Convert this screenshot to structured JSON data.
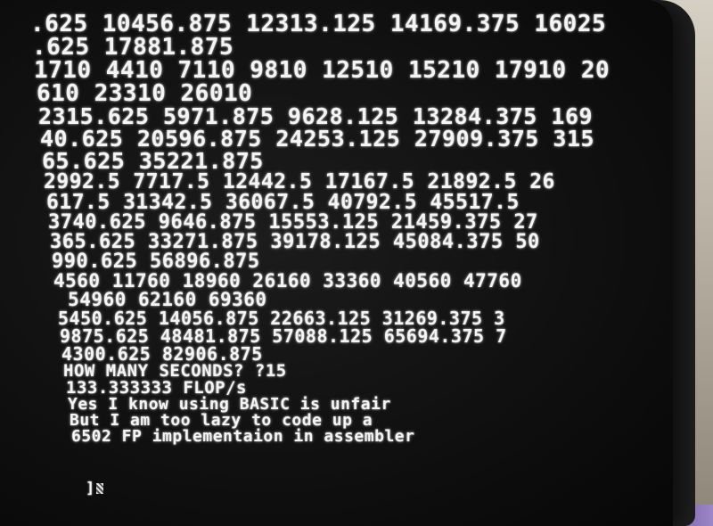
{
  "screen": {
    "lines": [
      {
        "text": ".625 10456.875 12313.125 14169.375 16025",
        "size": 26
      },
      {
        "text": ".625 17881.875",
        "size": 26
      },
      {
        "text": "1710 4410 7110 9810 12510 15210 17910 20",
        "size": 26
      },
      {
        "text": "610 23310 26010",
        "size": 26
      },
      {
        "text": "2315.625 5971.875 9628.125 13284.375 169",
        "size": 25
      },
      {
        "text": "40.625 20596.875 24253.125 27909.375 315",
        "size": 25
      },
      {
        "text": "65.625 35221.875",
        "size": 25
      },
      {
        "text": "2992.5 7717.5 12442.5 17167.5 21892.5 26",
        "size": 23
      },
      {
        "text": "617.5 31342.5 36067.5 40792.5 45517.5",
        "size": 23
      },
      {
        "text": "3740.625 9646.875 15553.125 21459.375 27",
        "size": 22
      },
      {
        "text": "365.625 33271.875 39178.125 45084.375 50",
        "size": 22
      },
      {
        "text": "990.625 56896.875",
        "size": 22
      },
      {
        "text": "4560 11760 18960 26160 33360 40560 47760",
        "size": 21
      },
      {
        "text": " 54960 62160 69360",
        "size": 21
      },
      {
        "text": "5450.625 14056.875 22663.125 31269.375 3",
        "size": 20
      },
      {
        "text": "9875.625 48481.875 57088.125 65694.375 7",
        "size": 20
      },
      {
        "text": "4300.625 82906.875",
        "size": 20
      },
      {
        "text": "HOW MANY SECONDS? ?15",
        "size": 19
      },
      {
        "text": "133.333333 FLOP/s",
        "size": 19
      },
      {
        "text": "Yes I know using BASIC is unfair",
        "size": 18
      },
      {
        "text": "But I am too lazy to code up a",
        "size": 18
      },
      {
        "text": "6502 FP implementaion in assembler",
        "size": 18
      }
    ],
    "prompt": "]"
  },
  "colors": {
    "phosphor": "#f4f4f4",
    "screen_bg": "#0d0d0d"
  }
}
